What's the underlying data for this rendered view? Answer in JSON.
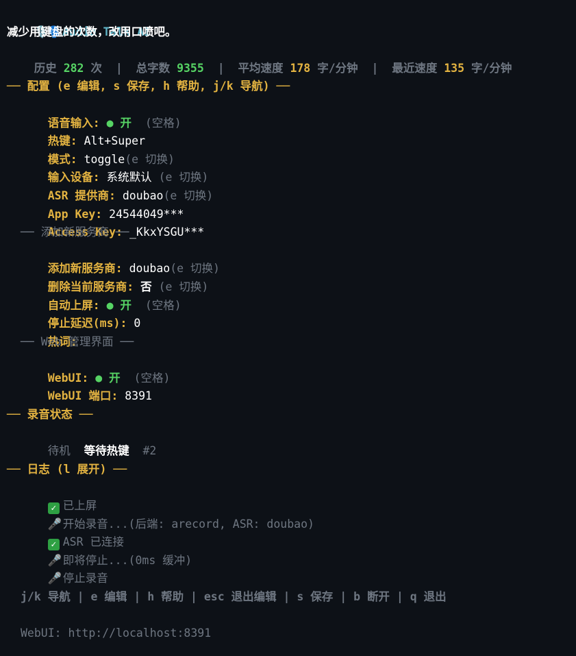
{
  "header": {
    "icons": "🎙️🗣️",
    "app_title": "Audio Talk AI",
    "tagline": "减少用键盘的次数，改用口喷吧。",
    "stats": {
      "history_label": "历史",
      "history_value": "282",
      "history_unit": "次",
      "chars_label": "总字数",
      "chars_value": "9355",
      "avg_label": "平均速度",
      "avg_value": "178",
      "avg_unit": "字/分钟",
      "recent_label": "最近速度",
      "recent_value": "135",
      "recent_unit": "字/分钟"
    }
  },
  "config": {
    "heading": "── 配置 (e 编辑, s 保存, h 帮助, j/k 导航) ──",
    "voice_input": {
      "label": "语音输入:",
      "dot": "●",
      "value": "开",
      "hint": "(空格)"
    },
    "hotkey": {
      "label": "热键:",
      "value": "Alt+Super"
    },
    "mode": {
      "label": "模式:",
      "value": "toggle",
      "hint": "(e 切换)"
    },
    "device": {
      "label": "输入设备:",
      "value": "系统默认",
      "hint": "(e 切换)"
    },
    "asr_provider": {
      "label": "ASR 提供商:",
      "value": "doubao",
      "hint": "(e 切换)"
    },
    "app_key": {
      "label": "App Key:",
      "value": "24544049***"
    },
    "access_key": {
      "label": "Access Key:",
      "value": "_KkxYSGU***"
    },
    "add_provider_heading": "── 添加新服务商 ──",
    "add_provider": {
      "label": "添加新服务商:",
      "value": "doubao",
      "hint": "(e 切换)"
    },
    "delete_provider": {
      "label": "删除当前服务商:",
      "value": "否",
      "hint": "(e 切换)"
    },
    "auto_paste": {
      "label": "自动上屏:",
      "dot": "●",
      "value": "开",
      "hint": "(空格)"
    },
    "stop_delay": {
      "label": "停止延迟(ms):",
      "value": "0"
    },
    "hotwords": {
      "label": "热词:"
    },
    "web_heading": "── Web 管理界面 ──",
    "webui": {
      "label": "WebUI:",
      "dot": "●",
      "value": "开",
      "hint": "(空格)"
    },
    "webui_port": {
      "label": "WebUI 端口:",
      "value": "8391"
    }
  },
  "recording": {
    "heading": "── 录音状态 ──",
    "state": "待机",
    "status": "等待热键",
    "count": "#2"
  },
  "log": {
    "heading": "── 日志 (l 展开) ──",
    "entries": [
      {
        "icon": "check-icon",
        "text": "已上屏"
      },
      {
        "icon": "mic-icon",
        "text": "开始录音...(后端: arecord, ASR: doubao)"
      },
      {
        "icon": "check-icon",
        "text": "ASR 已连接"
      },
      {
        "icon": "mic-icon",
        "text": "即将停止...(0ms 缓冲)"
      },
      {
        "icon": "mic-icon",
        "text": "停止录音"
      }
    ]
  },
  "footer": {
    "shortcuts": "j/k 导航 | e 编辑 | h 帮助 | esc 退出编辑 | s 保存 | b 断开 | q 退出",
    "webui_url": "WebUI: http://localhost:8391"
  },
  "colors": {
    "background": "#0d1117",
    "title": "#5fb3c6",
    "label_gold": "#e3b341",
    "stat_green": "#56d364",
    "dim": "#6e7681"
  }
}
